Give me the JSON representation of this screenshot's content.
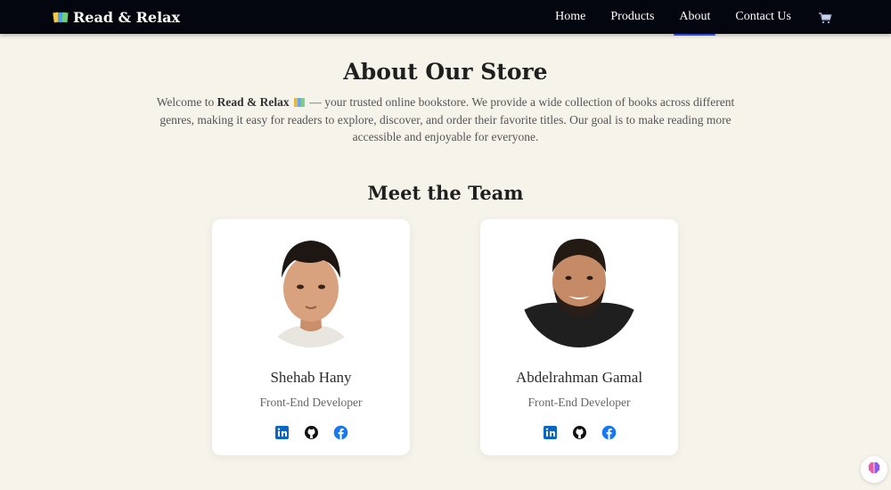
{
  "nav": {
    "brand": "Read & Relax",
    "brand_icon": "books-icon",
    "links": [
      {
        "label": "Home",
        "active": false
      },
      {
        "label": "Products",
        "active": false
      },
      {
        "label": "About",
        "active": true
      },
      {
        "label": "Contact Us",
        "active": false
      }
    ],
    "cart_icon": "cart-icon",
    "active_color": "#2a49e6"
  },
  "about": {
    "title": "About Our Store",
    "text_before": "Welcome to ",
    "store_name": "Read & Relax",
    "text_after": " — your trusted online bookstore. We provide a wide collection of books across different genres, making it easy for readers to explore, discover, and order their favorite titles. Our goal is to make reading more accessible and enjoyable for everyone."
  },
  "team": {
    "title": "Meet the Team",
    "members": [
      {
        "name": "Shehab Hany",
        "role": "Front-End Developer"
      },
      {
        "name": "Abdelrahman Gamal",
        "role": "Front-End Developer"
      }
    ],
    "social_icons": [
      "linkedin-icon",
      "github-icon",
      "facebook-icon"
    ]
  },
  "colors": {
    "navbar_bg": "#03060f",
    "page_bg": "#f5f3ea",
    "linkedin": "#0a66c2",
    "github": "#111111",
    "facebook": "#1877f2"
  }
}
